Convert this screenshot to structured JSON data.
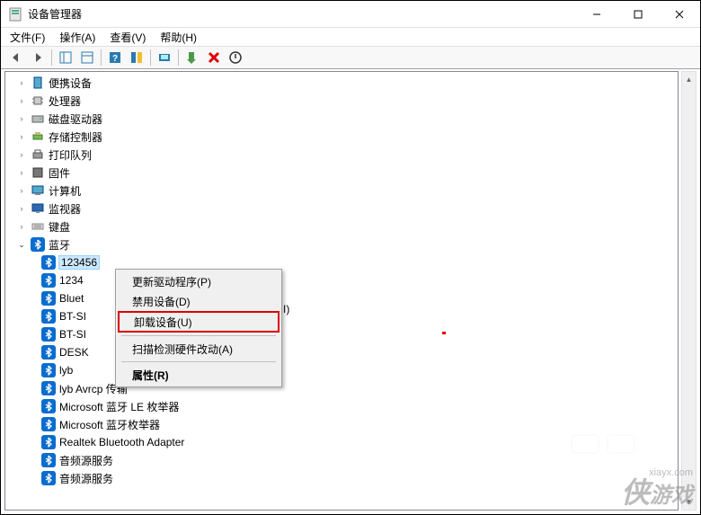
{
  "window": {
    "title": "设备管理器"
  },
  "menubar": {
    "file": "文件(F)",
    "action": "操作(A)",
    "view": "查看(V)",
    "help": "帮助(H)"
  },
  "tree": {
    "nodes": [
      {
        "label": "便携设备",
        "icon": "portable",
        "expanded": false
      },
      {
        "label": "处理器",
        "icon": "cpu",
        "expanded": false
      },
      {
        "label": "磁盘驱动器",
        "icon": "disk",
        "expanded": false
      },
      {
        "label": "存储控制器",
        "icon": "storage",
        "expanded": false
      },
      {
        "label": "打印队列",
        "icon": "printer",
        "expanded": false
      },
      {
        "label": "固件",
        "icon": "firmware",
        "expanded": false
      },
      {
        "label": "计算机",
        "icon": "computer",
        "expanded": false
      },
      {
        "label": "监视器",
        "icon": "monitor",
        "expanded": false
      },
      {
        "label": "键盘",
        "icon": "keyboard",
        "expanded": false
      },
      {
        "label": "蓝牙",
        "icon": "bluetooth",
        "expanded": true,
        "children": [
          {
            "label": "123456",
            "selected": true
          },
          {
            "label": "1234"
          },
          {
            "label": "Bluet"
          },
          {
            "label": "BT-SI"
          },
          {
            "label": "BT-SI"
          },
          {
            "label": "DESK"
          },
          {
            "label": "lyb"
          },
          {
            "label": "lyb Avrcp 传输"
          },
          {
            "label": "Microsoft 蓝牙 LE 枚举器"
          },
          {
            "label": "Microsoft 蓝牙枚举器"
          },
          {
            "label": "Realtek Bluetooth Adapter"
          },
          {
            "label": "音频源服务"
          },
          {
            "label": "音频源服务"
          }
        ]
      }
    ],
    "cutoff_suffix": "I)"
  },
  "context_menu": {
    "items": [
      {
        "label": "更新驱动程序(P)",
        "type": "item"
      },
      {
        "label": "禁用设备(D)",
        "type": "item"
      },
      {
        "label": "卸载设备(U)",
        "type": "item",
        "highlighted": true
      },
      {
        "type": "sep"
      },
      {
        "label": "扫描检测硬件改动(A)",
        "type": "item"
      },
      {
        "type": "sep"
      },
      {
        "label": "属性(R)",
        "type": "item",
        "bold": true
      }
    ]
  },
  "watermark": {
    "main": "侠",
    "sub": "游戏",
    "url": "xiayx.com"
  }
}
